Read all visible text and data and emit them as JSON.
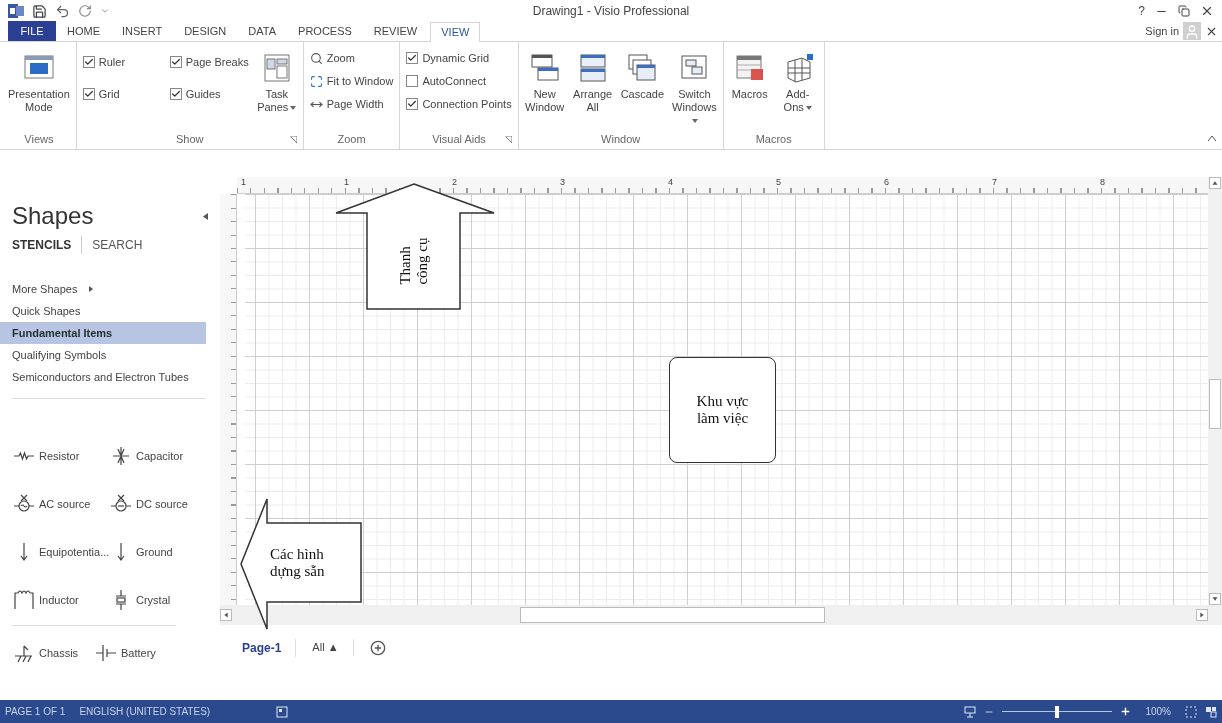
{
  "title_bar": {
    "title": "Drawing1 - Visio Professional",
    "help": "?"
  },
  "file_tab": "FILE",
  "tabs": [
    {
      "label": "HOME",
      "selected": false
    },
    {
      "label": "INSERT",
      "selected": false
    },
    {
      "label": "DESIGN",
      "selected": false
    },
    {
      "label": "DATA",
      "selected": false
    },
    {
      "label": "PROCESS",
      "selected": false
    },
    {
      "label": "REVIEW",
      "selected": false
    },
    {
      "label": "VIEW",
      "selected": true
    }
  ],
  "account": {
    "sign_in": "Sign in"
  },
  "ribbon": {
    "groups": [
      {
        "label": "Views",
        "launcher": false,
        "controls": [
          {
            "kind": "large",
            "label": "Presentation Mode",
            "dropdown": false
          }
        ]
      },
      {
        "label": "Show",
        "launcher": true,
        "controls": [
          {
            "kind": "check",
            "label": "Ruler",
            "checked": true
          },
          {
            "kind": "check",
            "label": "Page Breaks",
            "checked": true
          },
          {
            "kind": "check",
            "label": "Grid",
            "checked": true
          },
          {
            "kind": "check",
            "label": "Guides",
            "checked": true
          },
          {
            "kind": "large",
            "label": "Task Panes",
            "dropdown": true
          }
        ]
      },
      {
        "label": "Zoom",
        "launcher": false,
        "controls": [
          {
            "kind": "small",
            "label": "Zoom"
          },
          {
            "kind": "small",
            "label": "Fit to Window"
          },
          {
            "kind": "small",
            "label": "Page Width"
          }
        ]
      },
      {
        "label": "Visual Aids",
        "launcher": true,
        "controls": [
          {
            "kind": "check",
            "label": "Dynamic Grid",
            "checked": true
          },
          {
            "kind": "check",
            "label": "AutoConnect",
            "checked": false
          },
          {
            "kind": "check",
            "label": "Connection Points",
            "checked": true
          }
        ]
      },
      {
        "label": "Window",
        "launcher": false,
        "controls": [
          {
            "kind": "large",
            "label": "New Window",
            "dropdown": false
          },
          {
            "kind": "large",
            "label": "Arrange All",
            "dropdown": false
          },
          {
            "kind": "large",
            "label": "Cascade",
            "dropdown": false
          },
          {
            "kind": "large",
            "label": "Switch Windows",
            "dropdown": true
          }
        ]
      },
      {
        "label": "Macros",
        "launcher": false,
        "controls": [
          {
            "kind": "large",
            "label": "Macros",
            "dropdown": false
          },
          {
            "kind": "large",
            "label": "Add-Ons",
            "dropdown": true
          }
        ]
      }
    ]
  },
  "shapes_panel": {
    "title": "Shapes",
    "tabs": [
      {
        "label": "STENCILS",
        "selected": true
      },
      {
        "label": "SEARCH",
        "selected": false
      }
    ],
    "stencils": [
      {
        "label": "More Shapes",
        "kind": "submenu",
        "selected": false
      },
      {
        "label": "Quick Shapes",
        "kind": "item",
        "selected": false
      },
      {
        "label": "Fundamental Items",
        "kind": "item",
        "selected": true
      },
      {
        "label": "Qualifying Symbols",
        "kind": "item",
        "selected": false
      },
      {
        "label": "Semiconductors and Electron Tubes",
        "kind": "item",
        "selected": false
      }
    ],
    "shape_groups": [
      {
        "shapes": [
          {
            "label": "Resistor"
          },
          {
            "label": "Capacitor"
          },
          {
            "label": "AC source"
          },
          {
            "label": "DC source"
          },
          {
            "label": "Equipotentia..."
          },
          {
            "label": "Ground"
          },
          {
            "label": "Inductor"
          },
          {
            "label": "Crystal"
          }
        ]
      },
      {
        "shapes": [
          {
            "label": "Chassis"
          },
          {
            "label": "Battery"
          }
        ]
      }
    ]
  },
  "canvas": {
    "ruler_labels": [
      "1",
      "1",
      "2",
      "3",
      "4",
      "5",
      "6",
      "7",
      "8"
    ],
    "callouts": [
      {
        "kind": "up-arrow",
        "lines": [
          "Thanh",
          "công cụ"
        ]
      },
      {
        "kind": "box",
        "lines": [
          "Khu vực",
          "làm việc"
        ]
      },
      {
        "kind": "left-arrow",
        "lines": [
          "Các hình",
          "dựng sẵn"
        ]
      }
    ]
  },
  "page_tabs": [
    {
      "label": "Page-1",
      "selected": true
    }
  ],
  "all_pages": "All ▲",
  "status_bar": {
    "page": "PAGE 1 OF 1",
    "language": "ENGLISH (UNITED STATES)",
    "zoom": {
      "level": 0.5,
      "reading": "100%"
    }
  }
}
